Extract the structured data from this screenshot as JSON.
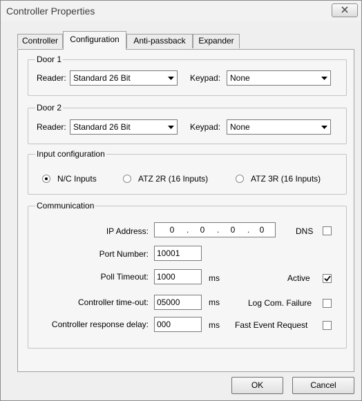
{
  "window": {
    "title": "Controller Properties",
    "close_icon": "close-icon"
  },
  "tabs": [
    {
      "label": "Controller"
    },
    {
      "label": "Configuration"
    },
    {
      "label": "Anti-passback"
    },
    {
      "label": "Expander"
    }
  ],
  "active_tab": "Configuration",
  "door1": {
    "legend": "Door 1",
    "reader_label": "Reader:",
    "reader_value": "Standard 26 Bit",
    "keypad_label": "Keypad:",
    "keypad_value": "None"
  },
  "door2": {
    "legend": "Door 2",
    "reader_label": "Reader:",
    "reader_value": "Standard 26 Bit",
    "keypad_label": "Keypad:",
    "keypad_value": "None"
  },
  "input_config": {
    "legend": "Input configuration",
    "options": [
      {
        "label": "N/C Inputs",
        "selected": true
      },
      {
        "label": "ATZ 2R (16 Inputs)",
        "selected": false
      },
      {
        "label": "ATZ 3R (16 Inputs)",
        "selected": false
      }
    ]
  },
  "communication": {
    "legend": "Communication",
    "ip_label": "IP Address:",
    "ip_octets": [
      "0",
      "0",
      "0",
      "0"
    ],
    "ip_dot": ".",
    "dns_label": "DNS",
    "dns_checked": false,
    "port_label": "Port Number:",
    "port_value": "10001",
    "poll_label": "Poll Timeout:",
    "poll_value": "1000",
    "poll_unit": "ms",
    "active_label": "Active",
    "active_checked": true,
    "timeout_label": "Controller time-out:",
    "timeout_value": "05000",
    "timeout_unit": "ms",
    "logfail_label": "Log Com. Failure",
    "logfail_checked": false,
    "delay_label": "Controller response delay:",
    "delay_value": "000",
    "delay_unit": "ms",
    "fast_label": "Fast Event Request",
    "fast_checked": false
  },
  "buttons": {
    "ok": "OK",
    "cancel": "Cancel"
  }
}
